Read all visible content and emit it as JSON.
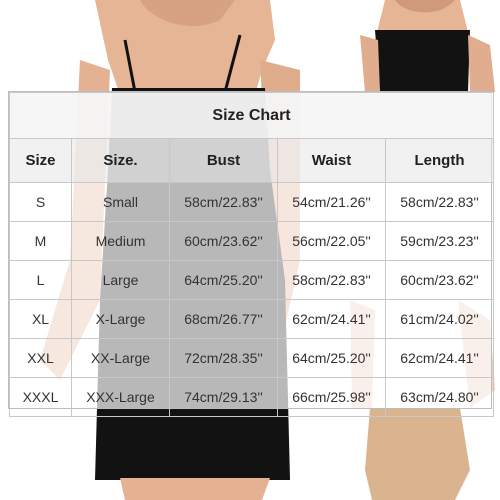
{
  "title": "Size Chart",
  "headers": [
    "Size",
    "Size.",
    "Bust",
    "Waist",
    "Length"
  ],
  "rows": [
    [
      "S",
      "Small",
      "58cm/22.83''",
      "54cm/21.26''",
      "58cm/22.83''"
    ],
    [
      "M",
      "Medium",
      "60cm/23.62''",
      "56cm/22.05''",
      "59cm/23.23''"
    ],
    [
      "L",
      "Large",
      "64cm/25.20''",
      "58cm/22.83''",
      "60cm/23.62''"
    ],
    [
      "XL",
      "X-Large",
      "68cm/26.77''",
      "62cm/24.41''",
      "61cm/24.02''"
    ],
    [
      "XXL",
      "XX-Large",
      "72cm/28.35''",
      "64cm/25.20''",
      "62cm/24.41''"
    ],
    [
      "XXXL",
      "XXX-Large",
      "74cm/29.13''",
      "66cm/25.98''",
      "63cm/24.80''"
    ]
  ],
  "colors": {
    "skin": "#e8b79b",
    "black_garment": "#111111",
    "nude_garment": "#d9b48f",
    "border": "#c8c8c8"
  }
}
